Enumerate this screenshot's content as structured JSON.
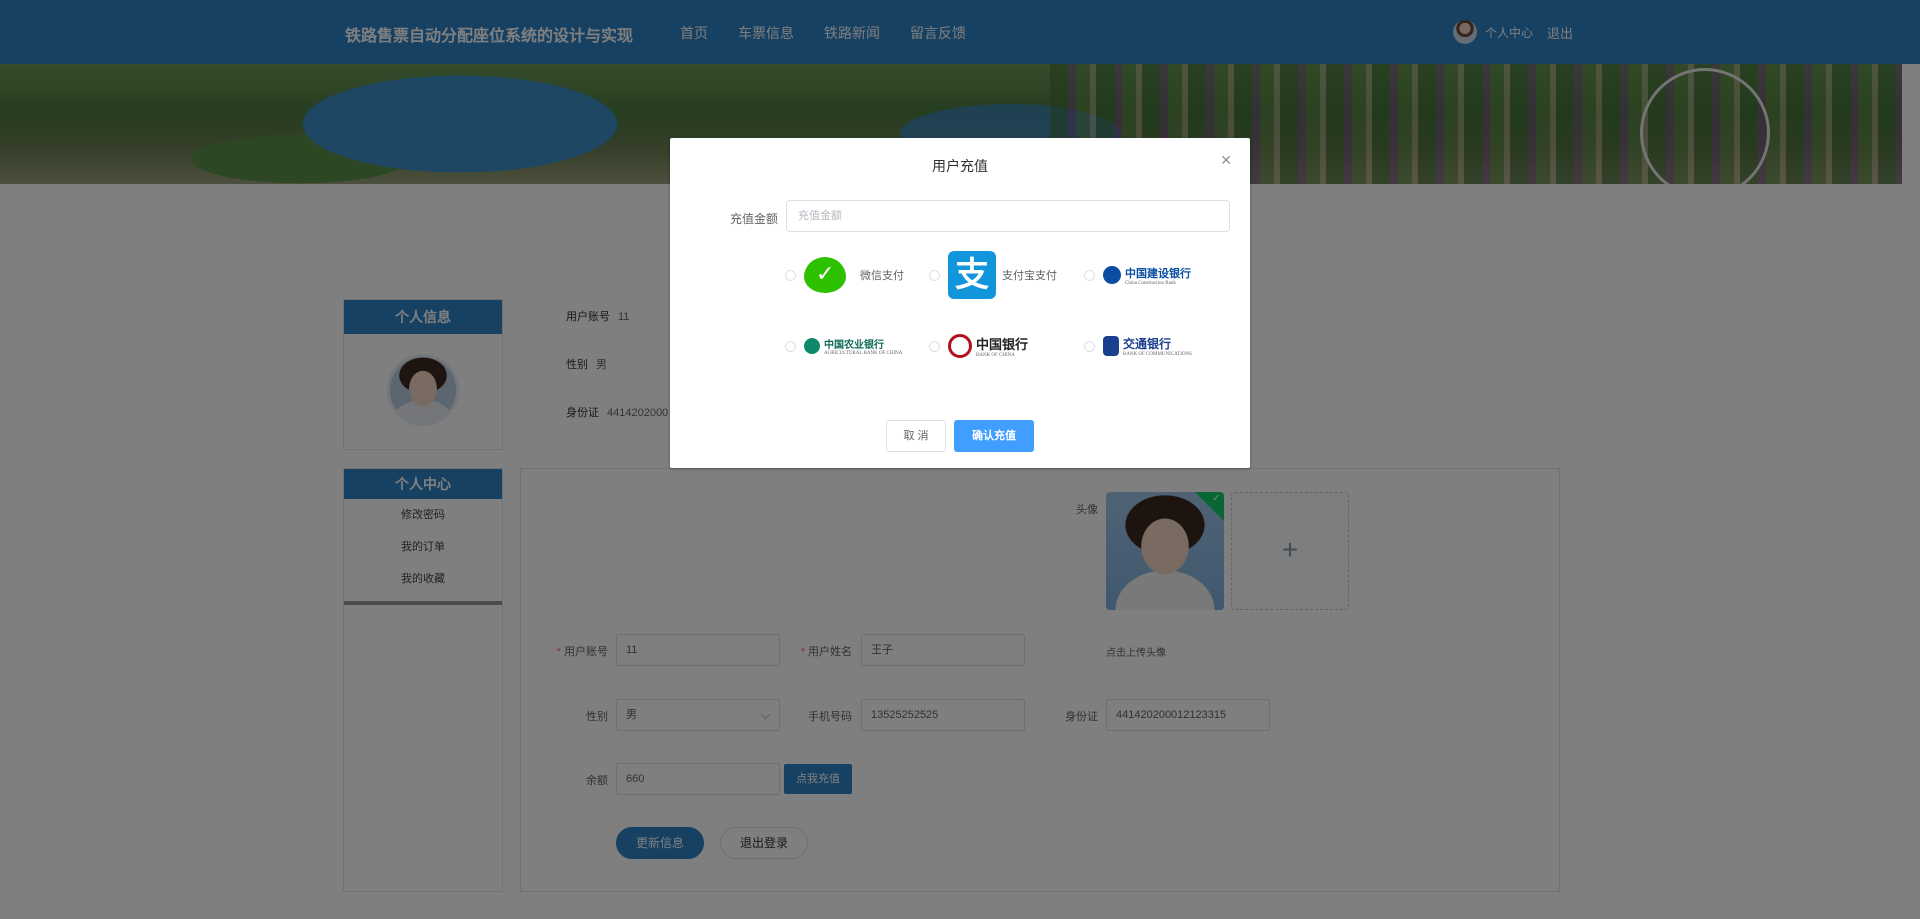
{
  "header": {
    "brand": "铁路售票自动分配座位系统的设计与实现",
    "nav": [
      "首页",
      "车票信息",
      "铁路新闻",
      "留言反馈"
    ],
    "user_center": "个人中心",
    "logout": "退出"
  },
  "sidebar": {
    "profile_title": "个人信息",
    "menu_title": "个人中心",
    "menu_items": [
      "修改密码",
      "我的订单",
      "我的收藏"
    ]
  },
  "profile_summary": {
    "account_label": "用户账号",
    "account_value": "11",
    "gender_label": "性别",
    "gender_value": "男",
    "id_label": "身份证",
    "id_value": "4414202000"
  },
  "form": {
    "avatar_label": "头像",
    "upload_tip": "点击上传头像",
    "account_label": "用户账号",
    "account_value": "11",
    "name_label": "用户姓名",
    "name_value": "王子",
    "gender_label": "性别",
    "gender_value": "男",
    "phone_label": "手机号码",
    "phone_value": "13525252525",
    "id_label": "身份证",
    "id_value": "441420200012123315",
    "balance_label": "余额",
    "balance_value": "660",
    "recharge_button": "点我充值",
    "update_button": "更新信息",
    "logout_button": "退出登录"
  },
  "modal": {
    "title": "用户充值",
    "amount_label": "充值金额",
    "amount_placeholder": "充值金额",
    "payment_options": [
      {
        "icon": "wechat-pay-logo",
        "label": "微信支付"
      },
      {
        "icon": "alipay-logo",
        "label": "支付宝支付"
      },
      {
        "icon": "ccb-logo",
        "label": "中国建设银行"
      },
      {
        "icon": "abc-logo",
        "label": "中国农业银行"
      },
      {
        "icon": "boc-logo",
        "label": "中国银行"
      },
      {
        "icon": "bocom-logo",
        "label": "交通银行"
      }
    ],
    "ccb_en": "China Construction Bank",
    "abc_en": "AGRICULTURAL BANK OF CHINA",
    "boc_en": "BANK OF CHINA",
    "bocom_en": "BANK OF COMMUNICATIONS",
    "cancel_button": "取 消",
    "confirm_button": "确认充值"
  },
  "colors": {
    "primary": "#2d83c7",
    "modal_primary": "#409eff",
    "wechat": "#2dc100",
    "alipay": "#1296db"
  }
}
